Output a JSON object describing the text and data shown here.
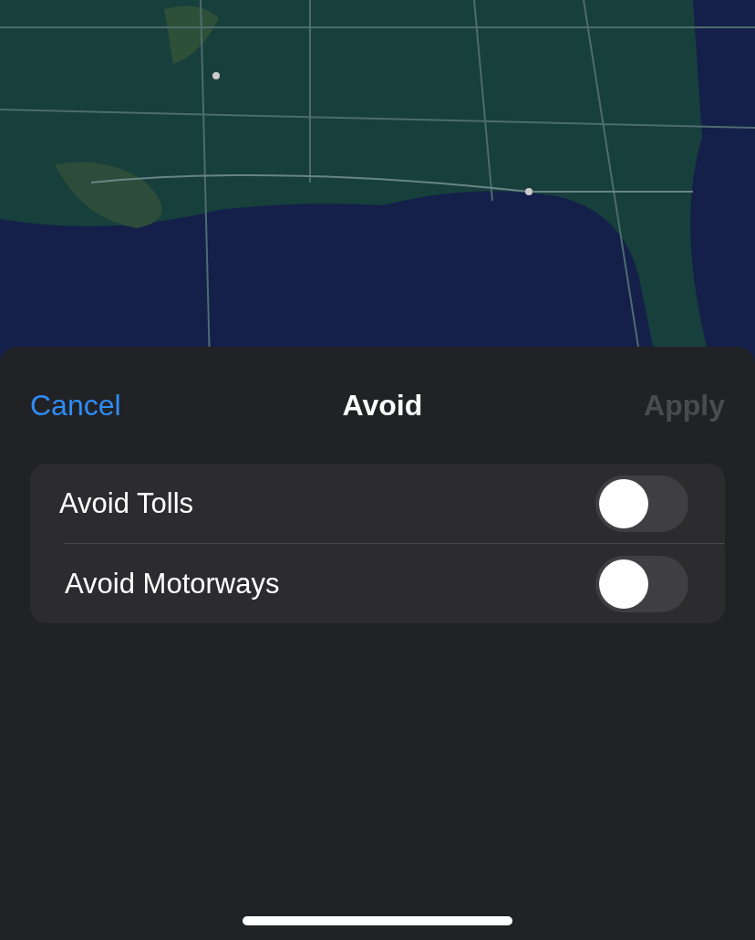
{
  "sheet": {
    "title": "Avoid",
    "cancel": "Cancel",
    "apply": {
      "label": "Apply",
      "disabled": true
    },
    "options": [
      {
        "label": "Avoid Tolls",
        "on": false
      },
      {
        "label": "Avoid Motorways",
        "on": false
      }
    ]
  }
}
